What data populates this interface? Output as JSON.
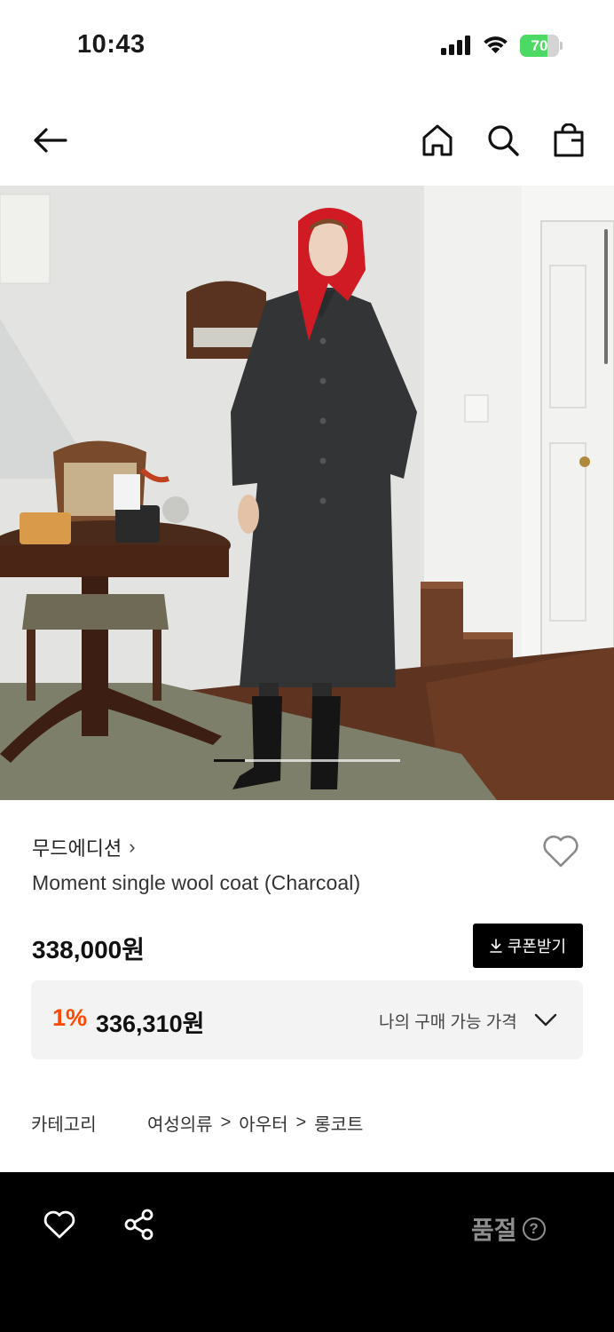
{
  "status_bar": {
    "time": "10:43",
    "battery_percent": "70",
    "battery_level": 0.7,
    "colors": {
      "battery_fill": "#4cd964"
    }
  },
  "nav": {
    "back_icon": "arrow-left-icon",
    "home_icon": "home-icon",
    "search_icon": "search-icon",
    "bag_icon": "shopping-bag-icon"
  },
  "gallery": {
    "description_icon": "product-photo",
    "current_slide": 1
  },
  "product": {
    "brand": "무드에디션",
    "brand_chevron": "›",
    "name": "Moment single wool coat (Charcoal)",
    "price": "338,000원",
    "coupon_label": "쿠폰받기",
    "coupon_icon": "download-icon",
    "wish_icon": "heart-outline-icon"
  },
  "member_price": {
    "rate": "1%",
    "price": "336,310원",
    "label": "나의 구매 가능 가격",
    "chevron_icon": "chevron-down-icon",
    "colors": {
      "rate": "#ff4800"
    }
  },
  "info": {
    "category_label": "카테고리",
    "category_path": [
      "여성의류",
      "아우터",
      "롱코트"
    ],
    "separator": ">"
  },
  "bottom_bar": {
    "like_icon": "heart-outline-icon",
    "share_icon": "share-icon",
    "soldout_label": "품절",
    "help_icon": "question-circle-icon",
    "help_glyph": "?"
  }
}
